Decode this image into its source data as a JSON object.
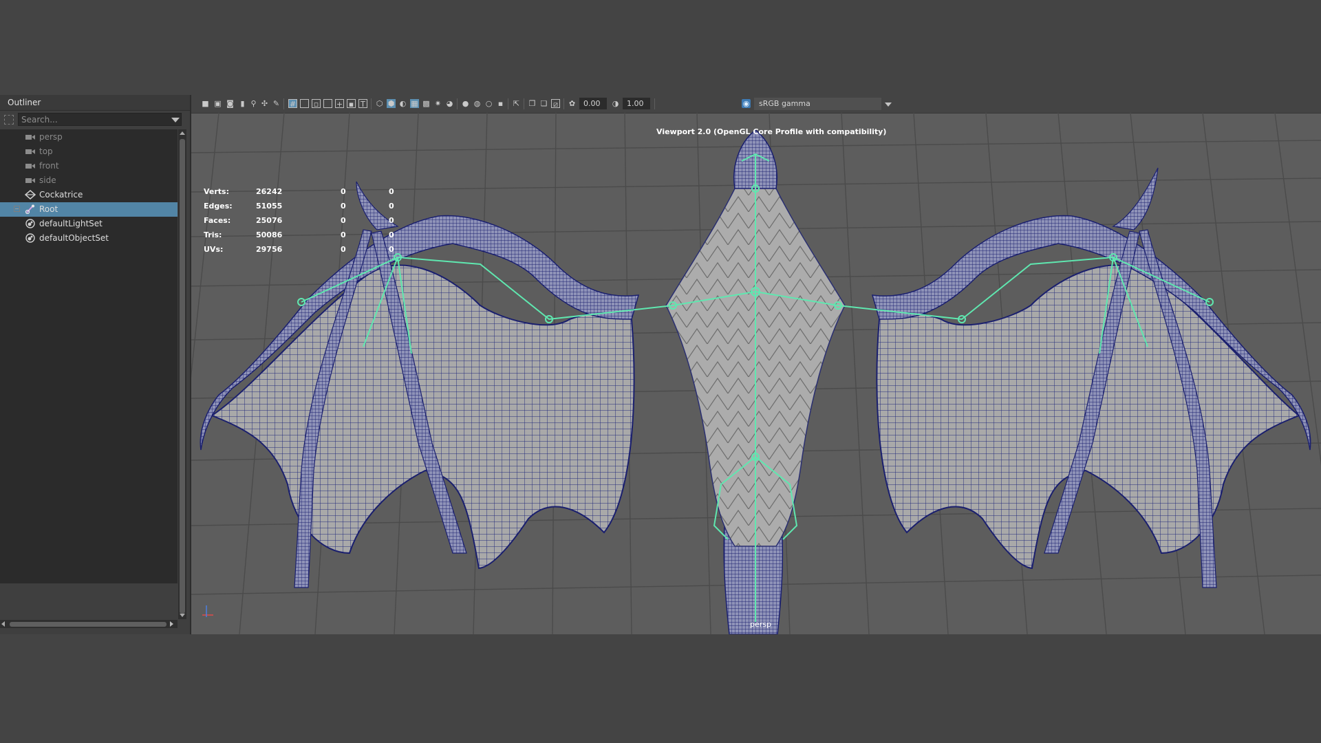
{
  "outliner": {
    "title": "Outliner",
    "search_placeholder": "Search...",
    "items": [
      {
        "label": "persp",
        "icon": "camera-icon",
        "dim": true
      },
      {
        "label": "top",
        "icon": "camera-icon",
        "dim": true
      },
      {
        "label": "front",
        "icon": "camera-icon",
        "dim": true
      },
      {
        "label": "side",
        "icon": "camera-icon",
        "dim": true
      },
      {
        "label": "Cockatrice",
        "icon": "transform-icon",
        "dim": false
      },
      {
        "label": "Root",
        "icon": "joint-icon",
        "dim": false,
        "selected": true
      },
      {
        "label": "defaultLightSet",
        "icon": "set-icon",
        "dim": false
      },
      {
        "label": "defaultObjectSet",
        "icon": "set-icon",
        "dim": false
      }
    ]
  },
  "viewport": {
    "toolbar": {
      "exposure": "0.00",
      "gamma": "1.00",
      "color_space": "sRGB gamma"
    },
    "hud": [
      {
        "label": "Verts:",
        "total": "26242",
        "selected": "0",
        "uv": "0"
      },
      {
        "label": "Edges:",
        "total": "51055",
        "selected": "0",
        "uv": "0"
      },
      {
        "label": "Faces:",
        "total": "25076",
        "selected": "0",
        "uv": "0"
      },
      {
        "label": "Tris:",
        "total": "50086",
        "selected": "0",
        "uv": "0"
      },
      {
        "label": "UVs:",
        "total": "29756",
        "selected": "0",
        "uv": "0"
      }
    ],
    "renderer": "Viewport 2.0 (OpenGL Core Profile with compatibility)",
    "camera": "persp",
    "colors": {
      "background": "#5d5d5d",
      "mesh_fill": "#a9a9a9",
      "wireframe": "#1a1f6e",
      "joints": "#5fe8b0",
      "selection": "#5285a6"
    }
  }
}
